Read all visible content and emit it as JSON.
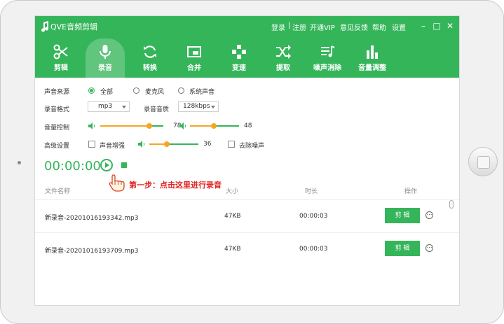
{
  "app": {
    "title": "QVE音频剪辑"
  },
  "titlebar": {
    "links": [
      {
        "label": "登录"
      },
      {
        "label": "|"
      },
      {
        "label": "注册"
      },
      {
        "label": "开通VIP"
      },
      {
        "label": "意见反馈"
      },
      {
        "label": "帮助"
      },
      {
        "label": "设置"
      }
    ],
    "window_buttons": [
      {
        "label": "–"
      },
      {
        "label": "□"
      },
      {
        "label": "✕"
      }
    ]
  },
  "toolbar": {
    "items": [
      {
        "label": "剪辑",
        "icon": "scissors-icon",
        "active": false
      },
      {
        "label": "录音",
        "icon": "microphone-icon",
        "active": true
      },
      {
        "label": "转换",
        "icon": "refresh-icon",
        "active": false
      },
      {
        "label": "合并",
        "icon": "merge-icon",
        "active": false
      },
      {
        "label": "变速",
        "icon": "speed-icon",
        "active": false
      },
      {
        "label": "提取",
        "icon": "shuffle-icon",
        "active": false
      },
      {
        "label": "噪声消除",
        "icon": "noise-removal-icon",
        "active": false
      },
      {
        "label": "音量调整",
        "icon": "volume-bars-icon",
        "active": false
      }
    ]
  },
  "settings": {
    "source": {
      "label": "声音来源",
      "options": [
        "全部",
        "麦克风",
        "系统声音"
      ],
      "selected": "全部"
    },
    "format": {
      "label": "录音格式",
      "value": "mp3"
    },
    "quality": {
      "label": "录音音质",
      "value": "128kbps"
    },
    "volume": {
      "label": "音量控制",
      "slider1": 78,
      "slider2": 48
    },
    "advanced": {
      "label": "高级设置",
      "enhance_label": "声音增强",
      "enhance_value": 36,
      "denoise_label": "去除噪声"
    }
  },
  "recorder": {
    "time": "00:00:00"
  },
  "callout": {
    "text": "第一步：点击这里进行录音"
  },
  "table": {
    "headers": {
      "name": "文件名称",
      "size": "大小",
      "duration": "时长",
      "action": "操作"
    },
    "rows": [
      {
        "name": "新录音-20201016193342.mp3",
        "size": "47KB",
        "duration": "00:00:03",
        "edit": "剪 辑"
      },
      {
        "name": "新录音-20201016193709.mp3",
        "size": "47KB",
        "duration": "00:00:03",
        "edit": "剪 辑"
      }
    ],
    "more_icon": "⋯"
  },
  "colors": {
    "brand": "#35b55a",
    "accent": "#f5a623",
    "callout": "#e02424"
  }
}
